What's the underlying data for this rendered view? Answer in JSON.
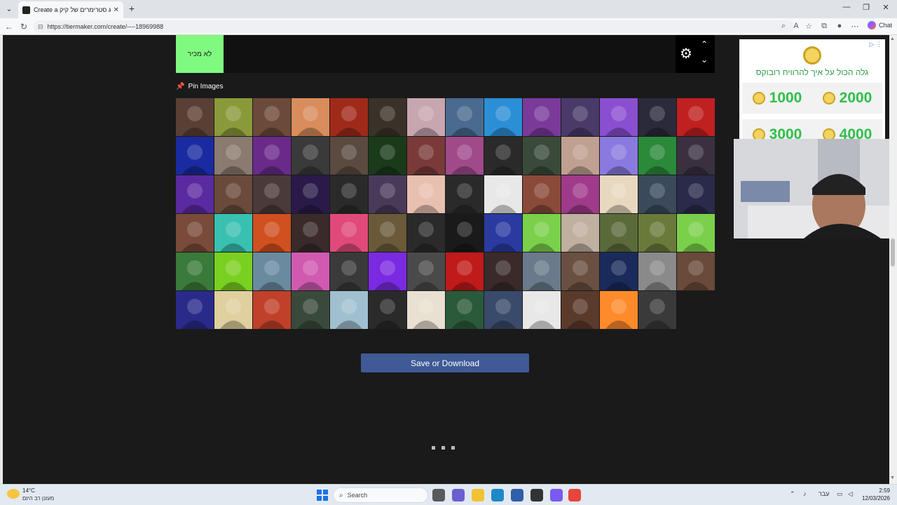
{
  "browser": {
    "tab_title": "Create a דירוג סטרימרים של קיק T",
    "url": "https://tiermaker.com/create/----18969988",
    "chat_label": "Chat"
  },
  "tier": {
    "label": "לא מכיר",
    "label_color": "#7ffa7f"
  },
  "pin": {
    "label": "Pin Images"
  },
  "images": {
    "colors": [
      [
        "#5a3f34",
        "#8a9a3a",
        "#6b4a3a",
        "#d98c5c",
        "#a02a1a",
        "#3a3228",
        "#c8a6b0",
        "#4a6a90",
        "#2b8fd6",
        "#7a3a9a",
        "#4a3a6a",
        "#8a4fd0",
        "#2a2a3a",
        "#c02020"
      ],
      [
        "#1a2aa0",
        "#8a7a70",
        "#6a2a8a",
        "#3a3a3a",
        "#5a4a40",
        "#1a3a1a",
        "#7a3a3a",
        "#a04a8a",
        "#2a2a2a",
        "#3a4a3a",
        "#c0a090",
        "#8a7ae0",
        "#2a8a3a",
        "#3a3040"
      ],
      [
        "#5a2aa0",
        "#6a4a3a",
        "#4a3a3a",
        "#2a1a4a",
        "#2a2a2a",
        "#4a3a5a",
        "#e8c0b0",
        "#2a2a2a",
        "#e8e8e8",
        "#8a4a3a",
        "#a03a8a",
        "#e8d8c0",
        "#3a4a5a",
        "#2a2a4a"
      ],
      [
        "#7a4a3a",
        "#3ac0b0",
        "#d05020",
        "#3a2a2a",
        "#e04a7a",
        "#6a5a3a",
        "#2a2a2a",
        "#1a1a1a",
        "#2a3aa0",
        "#7ad04a",
        "#c0b0a0",
        "#5a6a3a",
        "#6a7a3a",
        "#7ad04a"
      ],
      [
        "#3a7a3a",
        "#7ad020",
        "#6a8aa0",
        "#d05ab0",
        "#3a3a3a",
        "#7a2ae0",
        "#4a4a4a",
        "#c01a1a",
        "#3a2a2a",
        "#6a7a8a",
        "#6a5040",
        "#1a2a5a",
        "#8a8a8a",
        "#6a4a3a"
      ],
      [
        "#2a2a8a",
        "#e0d0a0",
        "#c0402a",
        "#3a4a3a",
        "#a0c0d0",
        "#2a2a2a",
        "#e8e0d0",
        "#2a5a3a",
        "#3a4a6a",
        "#e8e8e8",
        "#5a3a2a",
        "#ff8a2a",
        "#3a3a3a"
      ]
    ]
  },
  "actions": {
    "save_label": "Save or Download"
  },
  "ad": {
    "headline": "גלה הכול על איך להרוויח רובוקס",
    "amounts": [
      "1000",
      "2000",
      "3000",
      "4000"
    ]
  },
  "taskbar": {
    "temperature": "14°C",
    "weather": "מעונן רב היום",
    "search_label": "Search",
    "language": "עבר",
    "time": "2:59",
    "date": "12/03/2026"
  }
}
